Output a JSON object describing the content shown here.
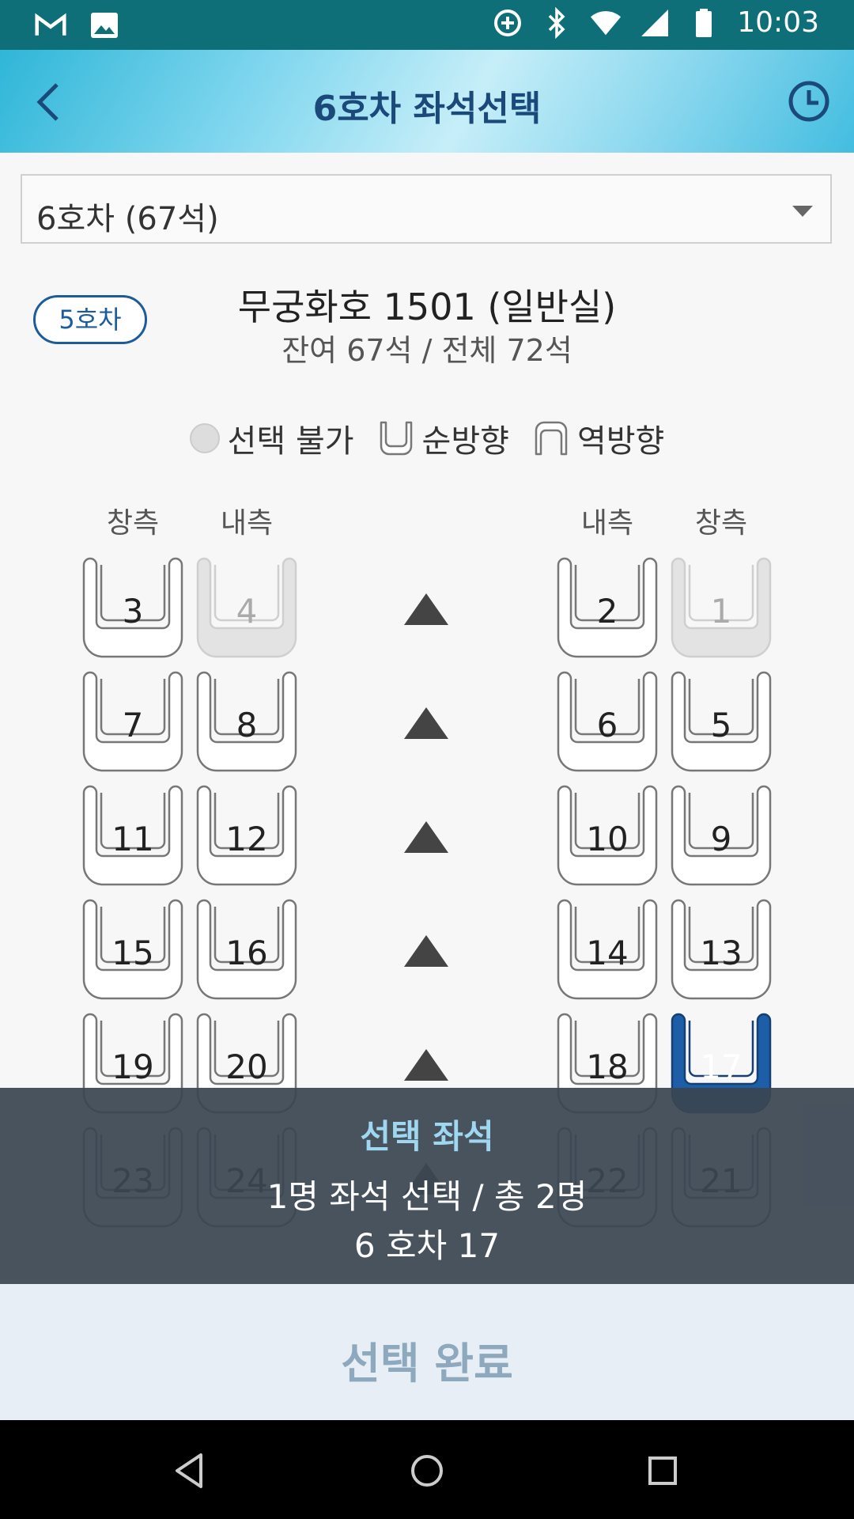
{
  "status_bar": {
    "time": "10:03"
  },
  "header": {
    "title": "6호차 좌석선택"
  },
  "car_select": {
    "value": "6호차 (67석)"
  },
  "train": {
    "prev_car_label": "5호차",
    "name": "무궁화호 1501 (일반실)",
    "seats_info": "잔여 67석 / 전체 72석"
  },
  "legend": {
    "unavailable": "선택 불가",
    "forward": "순방향",
    "backward": "역방향"
  },
  "columns": {
    "left_window": "창측",
    "left_aisle": "내측",
    "right_aisle": "내측",
    "right_window": "창측"
  },
  "seats": {
    "rows": [
      {
        "left_window": "3",
        "left_aisle": "4",
        "right_aisle": "2",
        "right_window": "1"
      },
      {
        "left_window": "7",
        "left_aisle": "8",
        "right_aisle": "6",
        "right_window": "5"
      },
      {
        "left_window": "11",
        "left_aisle": "12",
        "right_aisle": "10",
        "right_window": "9"
      },
      {
        "left_window": "15",
        "left_aisle": "16",
        "right_aisle": "14",
        "right_window": "13"
      },
      {
        "left_window": "19",
        "left_aisle": "20",
        "right_aisle": "18",
        "right_window": "17"
      },
      {
        "left_window": "23",
        "left_aisle": "24",
        "right_aisle": "22",
        "right_window": "21"
      }
    ],
    "unavailable": [
      "4",
      "1"
    ],
    "selected": [
      "17"
    ]
  },
  "selection_panel": {
    "title": "선택 좌석",
    "count_text": "1명 좌석 선택 / 총 2명",
    "seat_text": "6 호차 17"
  },
  "confirm_button": {
    "label": "선택 완료"
  },
  "colors": {
    "header_title": "#1b4a7a",
    "selected_seat": "#1d5ea8",
    "overlay": "#3a4652",
    "confirm_text": "#8ea9bd"
  }
}
